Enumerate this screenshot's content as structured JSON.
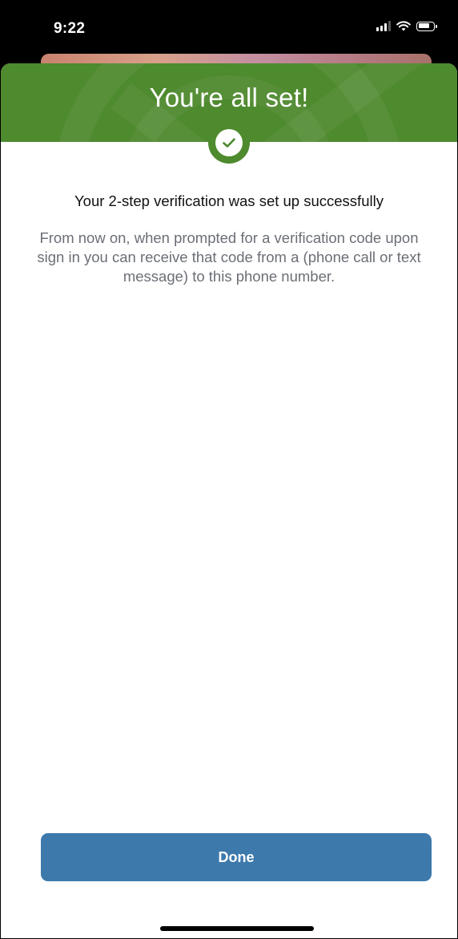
{
  "status_bar": {
    "time": "9:22",
    "icons": [
      "cellular-signal-icon",
      "wifi-icon",
      "battery-icon"
    ]
  },
  "sheet": {
    "title": "You're all set!",
    "badge_icon": "checkmark-circle-icon",
    "headline": "Your 2-step verification was set up successfully",
    "body": "From now on, when prompted for a verification code upon sign in you can receive that code from a (phone call or text message) to this phone number.",
    "done_label": "Done"
  },
  "colors": {
    "header_green": "#4e8a2e",
    "button_blue": "#3d79ab",
    "body_gray": "#6b6f76"
  }
}
